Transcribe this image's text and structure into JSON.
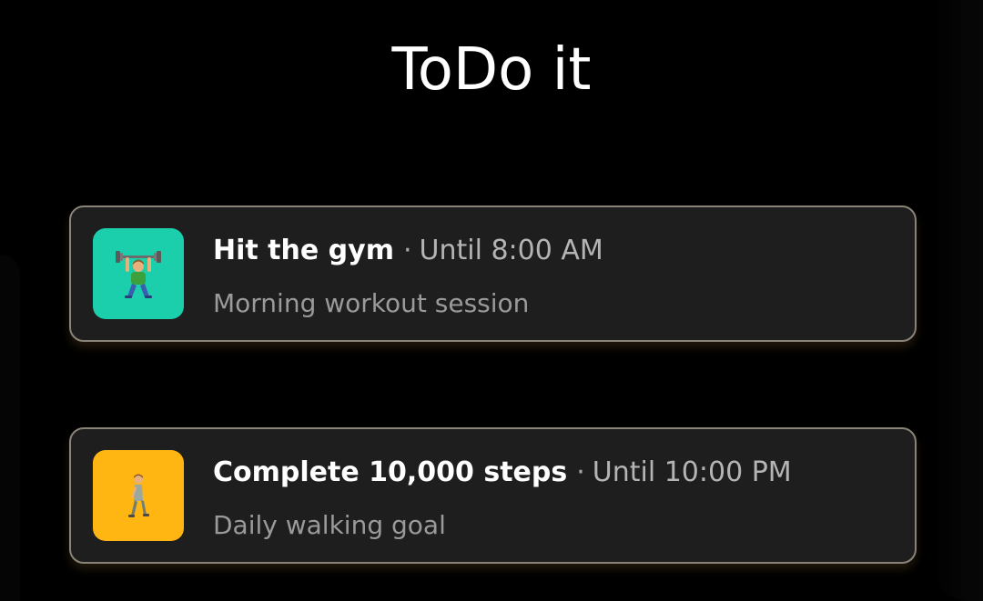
{
  "app": {
    "title": "ToDo it"
  },
  "tasks": [
    {
      "title": "Hit the gym",
      "separator": "·",
      "deadline": "Until 8:00 AM",
      "subtitle": "Morning workout session",
      "icon": "weightlifter-icon",
      "tile_color": "#1ccfac"
    },
    {
      "title": "Complete 10,000 steps",
      "separator": "·",
      "deadline": "Until 10:00 PM",
      "subtitle": "Daily walking goal",
      "icon": "walking-person-icon",
      "tile_color": "#ffb612"
    }
  ]
}
